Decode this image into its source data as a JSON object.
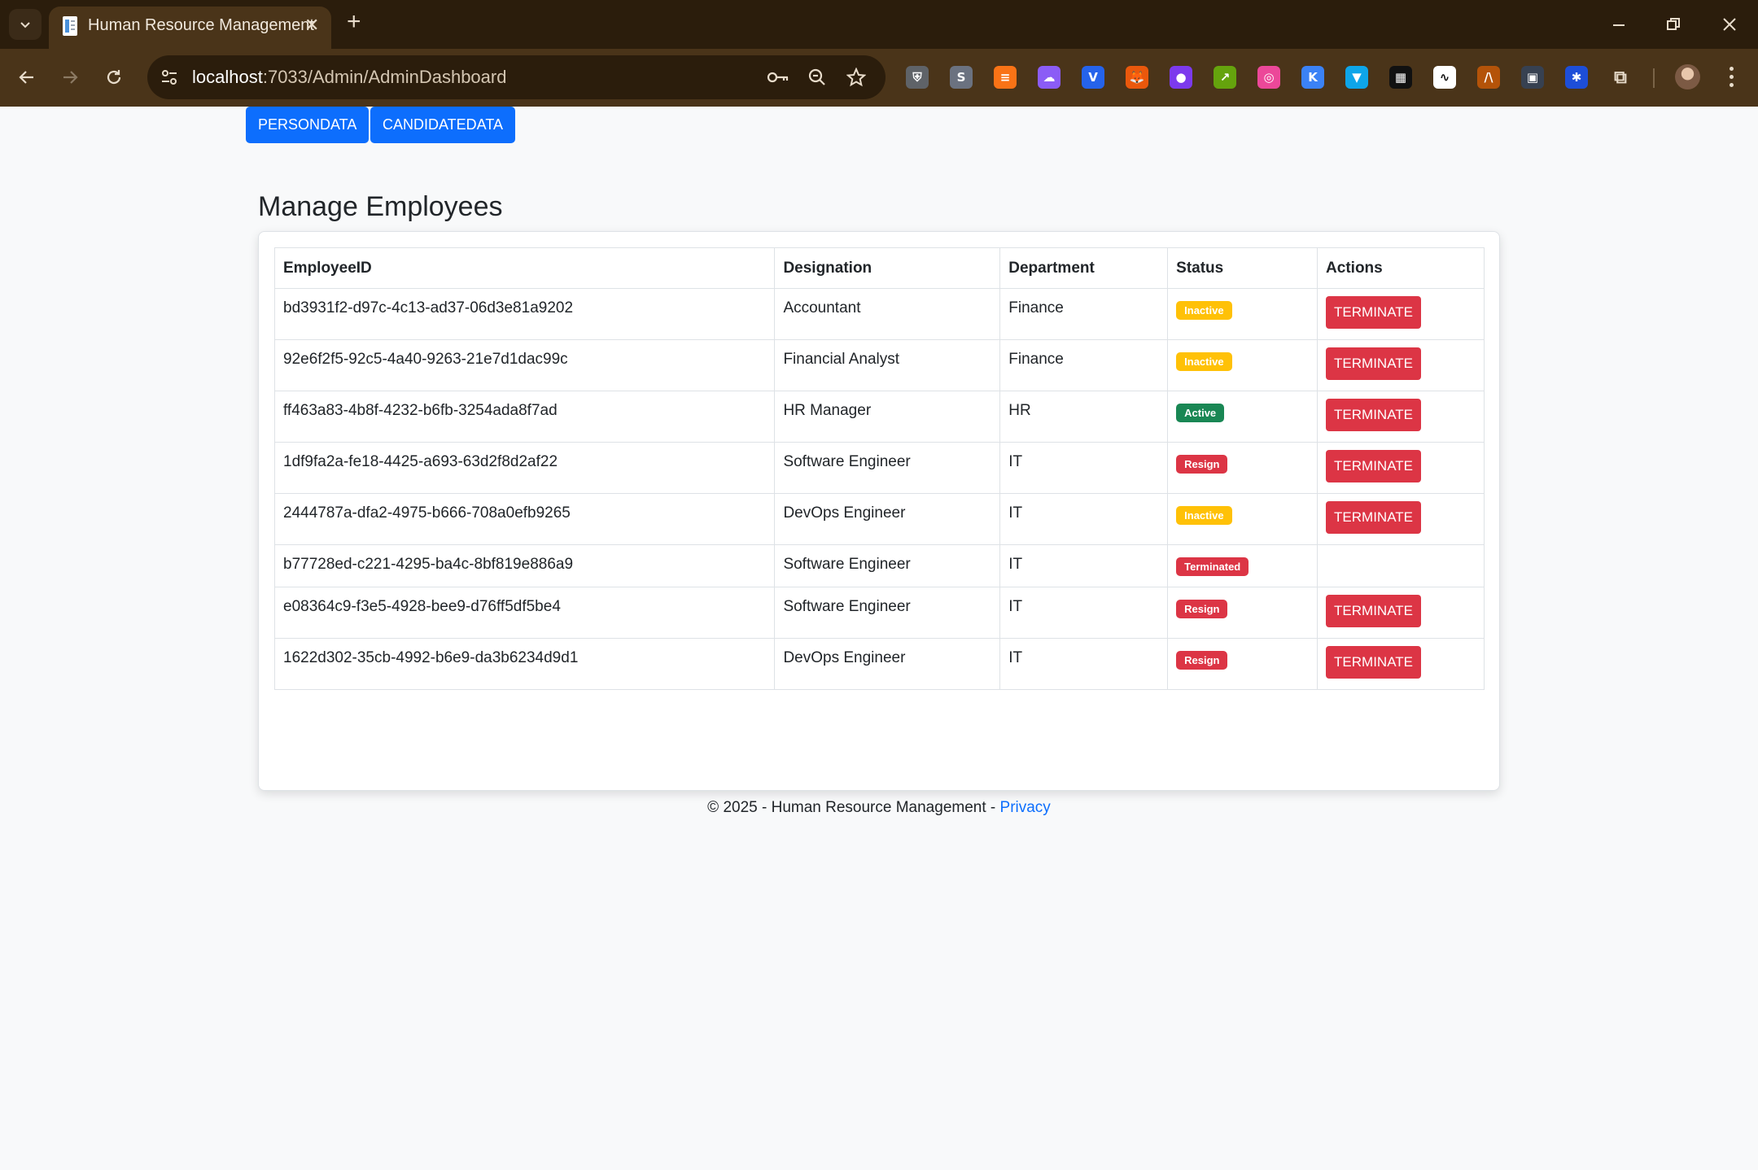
{
  "browser": {
    "tab_title": "Human Resource Management",
    "url_host": "localhost",
    "url_path": ":7033/Admin/AdminDashboard",
    "extensions": [
      {
        "name": "shield-extension-icon",
        "glyph": "⛨",
        "bg": "#5f6368"
      },
      {
        "name": "s-extension-icon",
        "glyph": "S",
        "bg": "#6b7280"
      },
      {
        "name": "stripes-extension-icon",
        "glyph": "≡",
        "bg": "#f97316"
      },
      {
        "name": "cloud-extension-icon",
        "glyph": "☁",
        "bg": "#8b5cf6"
      },
      {
        "name": "v-extension-icon",
        "glyph": "V",
        "bg": "#2563eb"
      },
      {
        "name": "fox-extension-icon",
        "glyph": "🦊",
        "bg": "#ea580c"
      },
      {
        "name": "robot-extension-icon",
        "glyph": "●",
        "bg": "#7c3aed"
      },
      {
        "name": "chart-extension-icon",
        "glyph": "↗",
        "bg": "#65a30d"
      },
      {
        "name": "ring-extension-icon",
        "glyph": "◎",
        "bg": "#ec4899"
      },
      {
        "name": "k-extension-icon",
        "glyph": "K",
        "bg": "#3b82f6"
      },
      {
        "name": "diamond-extension-icon",
        "glyph": "▼",
        "bg": "#0ea5e9"
      },
      {
        "name": "grid-extension-icon",
        "glyph": "▦",
        "bg": "#111111"
      },
      {
        "name": "wave-extension-icon",
        "glyph": "∿",
        "bg": "#ffffff"
      },
      {
        "name": "signature-extension-icon",
        "glyph": "/\\",
        "bg": "#b45309"
      },
      {
        "name": "qr-extension-icon",
        "glyph": "▣",
        "bg": "#374151"
      },
      {
        "name": "snowflake-extension-icon",
        "glyph": "✱",
        "bg": "#1d4ed8"
      },
      {
        "name": "puzzle-extensions-icon",
        "glyph": "⧉",
        "bg": "transparent"
      }
    ]
  },
  "nav": {
    "buttons": [
      "PERSONDATA",
      "CANDIDATEDATA"
    ]
  },
  "page_title": "Manage Employees",
  "table": {
    "headers": [
      "EmployeeID",
      "Designation",
      "Department",
      "Status",
      "Actions"
    ],
    "action_label": "TERMINATE",
    "rows": [
      {
        "id": "bd3931f2-d97c-4c13-ad37-06d3e81a9202",
        "designation": "Accountant",
        "department": "Finance",
        "status": "Inactive",
        "has_action": true
      },
      {
        "id": "92e6f2f5-92c5-4a40-9263-21e7d1dac99c",
        "designation": "Financial Analyst",
        "department": "Finance",
        "status": "Inactive",
        "has_action": true
      },
      {
        "id": "ff463a83-4b8f-4232-b6fb-3254ada8f7ad",
        "designation": "HR Manager",
        "department": "HR",
        "status": "Active",
        "has_action": true
      },
      {
        "id": "1df9fa2a-fe18-4425-a693-63d2f8d2af22",
        "designation": "Software Engineer",
        "department": "IT",
        "status": "Resign",
        "has_action": true
      },
      {
        "id": "2444787a-dfa2-4975-b666-708a0efb9265",
        "designation": "DevOps Engineer",
        "department": "IT",
        "status": "Inactive",
        "has_action": true
      },
      {
        "id": "b77728ed-c221-4295-ba4c-8bf819e886a9",
        "designation": "Software Engineer",
        "department": "IT",
        "status": "Terminated",
        "has_action": false
      },
      {
        "id": "e08364c9-f3e5-4928-bee9-d76ff5df5be4",
        "designation": "Software Engineer",
        "department": "IT",
        "status": "Resign",
        "has_action": true
      },
      {
        "id": "1622d302-35cb-4992-b6e9-da3b6234d9d1",
        "designation": "DevOps Engineer",
        "department": "IT",
        "status": "Resign",
        "has_action": true
      }
    ]
  },
  "status_colors": {
    "Inactive": {
      "bg": "#ffc107",
      "fg": "#ffffff"
    },
    "Active": {
      "bg": "#198754",
      "fg": "#ffffff"
    },
    "Resign": {
      "bg": "#dc3545",
      "fg": "#ffffff"
    },
    "Terminated": {
      "bg": "#dc3545",
      "fg": "#ffffff"
    }
  },
  "footer": {
    "text": "© 2025 - Human Resource Management - ",
    "link": "Privacy"
  }
}
